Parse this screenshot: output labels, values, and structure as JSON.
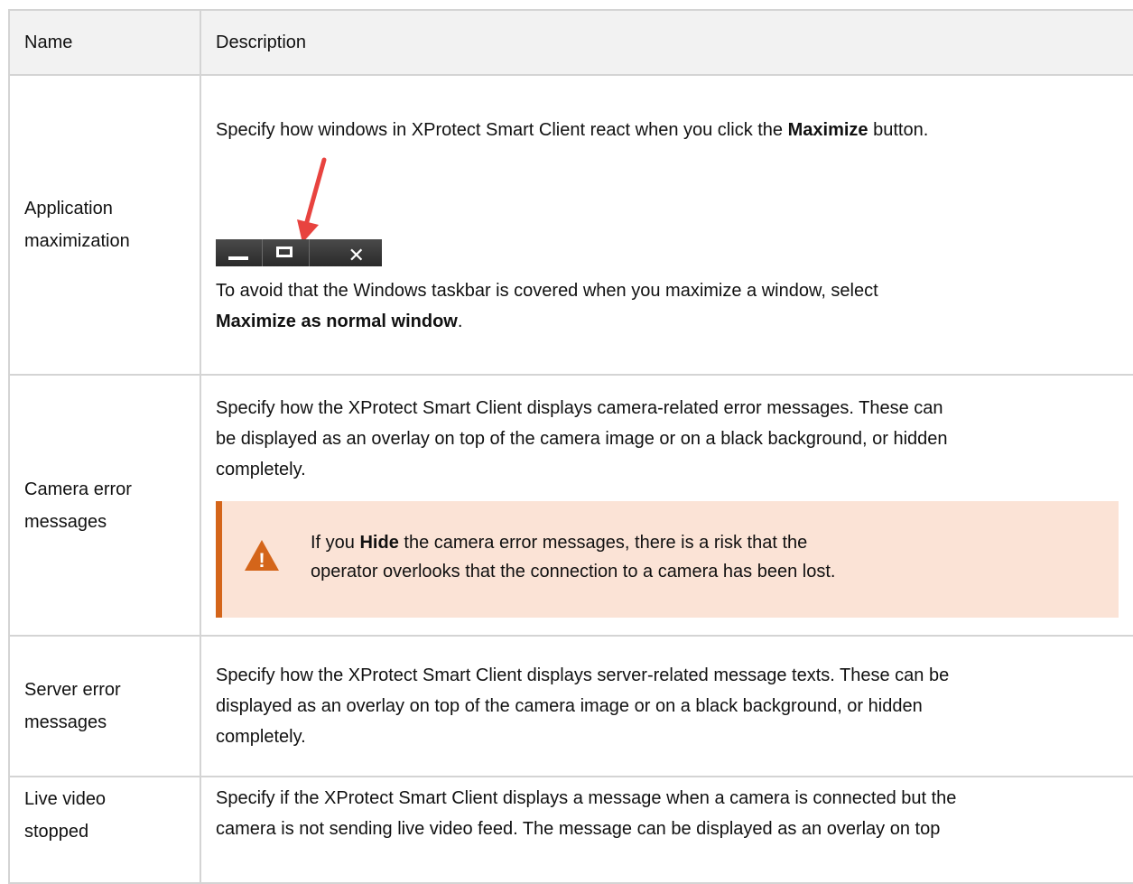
{
  "header": {
    "name": "Name",
    "description": "Description"
  },
  "rows": [
    {
      "name_line1": "Application",
      "name_line2": "maximization",
      "desc_pre": "Specify how windows in XProtect Smart Client react when you click the ",
      "desc_bold": "Maximize",
      "desc_post": " button.",
      "note_pre": "To avoid that the Windows taskbar is covered when you maximize a window, select",
      "note_bold": "Maximize as normal window",
      "note_post": "."
    },
    {
      "name_line1": "Camera error",
      "name_line2": "messages",
      "desc_line1": "Specify how the XProtect Smart Client displays camera-related error messages. These can",
      "desc_line2": "be displayed as an overlay on top of the camera image or on a black background, or hidden",
      "desc_line3": "completely.",
      "warning_pre": "If you ",
      "warning_bold": "Hide",
      "warning_post": " the camera error messages, there is a risk that the",
      "warning_line2": "operator overlooks that the connection to a camera has been lost."
    },
    {
      "name_line1": "Server error",
      "name_line2": "messages",
      "desc_line1": "Specify how the XProtect Smart Client displays server-related message texts. These can be",
      "desc_line2": "displayed as an overlay on top of the camera image or on a black background, or hidden",
      "desc_line3": "completely."
    },
    {
      "name_line1": "Live video",
      "name_line2": "stopped",
      "desc_line1": "Specify if the XProtect Smart Client displays a message when a camera is connected but the",
      "desc_line2": "camera is not sending live video feed. The message can be displayed as an overlay on top"
    }
  ],
  "icons": {
    "warning": "warning-triangle-icon",
    "arrow": "red-arrow-icon",
    "window_buttons": [
      "minimize-icon",
      "maximize-icon",
      "close-icon"
    ]
  },
  "colors": {
    "warning_background": "#fbe3d6",
    "warning_accent": "#d4651a",
    "arrow": "#e8433f",
    "header_background": "#f2f2f2"
  },
  "glyphs": {
    "close": "✕",
    "warning": "!"
  }
}
